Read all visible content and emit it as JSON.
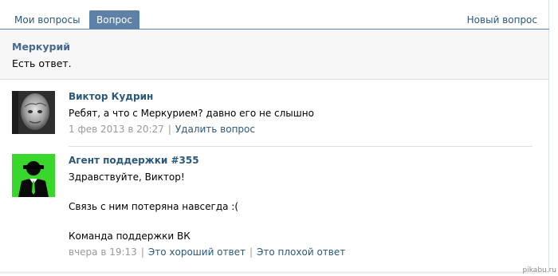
{
  "tabs": {
    "my_questions": "Мои вопросы",
    "question": "Вопрос",
    "new_question": "Новый вопрос"
  },
  "topic": {
    "title": "Меркурий",
    "status": "Есть ответ."
  },
  "messages": [
    {
      "author": "Виктор Кудрин",
      "lines": [
        "Ребят, а что с Меркурием? давно его не слышно"
      ],
      "date": "1 фев 2013 в 20:27",
      "actions": [
        "Удалить вопрос"
      ]
    },
    {
      "author": "Агент поддержки #355",
      "lines": [
        "Здравствуйте, Виктор!",
        "Связь с ним потеряна навсегда :(",
        "Команда поддержки ВК"
      ],
      "date": "вчера в 19:13",
      "actions": [
        "Это хороший ответ",
        "Это плохой ответ"
      ]
    }
  ],
  "watermark": "pikabu.ru",
  "colors": {
    "link": "#2b587a",
    "tab_active_bg": "#5e81a8",
    "agent_avatar_bg": "#39d62c"
  }
}
